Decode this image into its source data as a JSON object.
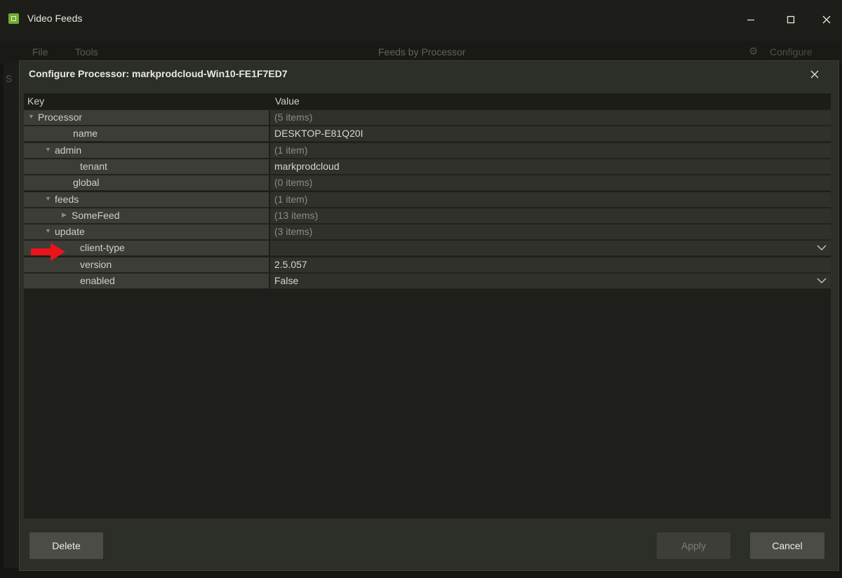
{
  "window": {
    "title": "Video Feeds",
    "controls": {
      "minimize": "—",
      "maximize": "☐",
      "close": "✕"
    }
  },
  "menubar": {
    "items": [
      {
        "label": "File"
      },
      {
        "label": "Tools"
      }
    ],
    "view_title": "Feeds by Processor",
    "configure_icon": "gear-icon",
    "configure_label": "Configure",
    "background_letter": "S"
  },
  "dialog": {
    "title": "Configure Processor: markprodcloud-Win10-FE1F7ED7",
    "close_icon": "✕",
    "columns": {
      "key": "Key",
      "value": "Value"
    },
    "rows": [
      {
        "key": "Processor",
        "value": "(5 items)",
        "depth": 0,
        "expander": "expanded"
      },
      {
        "key": "name",
        "value": "DESKTOP-E81Q20I",
        "depth": 1,
        "expander": "none"
      },
      {
        "key": "admin",
        "value": "(1 item)",
        "depth": 1,
        "expander": "expanded"
      },
      {
        "key": "tenant",
        "value": "markprodcloud",
        "depth": 2,
        "expander": "none"
      },
      {
        "key": "global",
        "value": "(0 items)",
        "depth": 1,
        "expander": "none"
      },
      {
        "key": "feeds",
        "value": "(1 item)",
        "depth": 1,
        "expander": "expanded"
      },
      {
        "key": "SomeFeed",
        "value": "(13 items)",
        "depth": 2,
        "expander": "collapsed"
      },
      {
        "key": "update",
        "value": "(3 items)",
        "depth": 1,
        "expander": "expanded"
      },
      {
        "key": "client-type",
        "value": "",
        "depth": 2,
        "expander": "none",
        "dropdown": true
      },
      {
        "key": "version",
        "value": "2.5.057",
        "depth": 2,
        "expander": "none"
      },
      {
        "key": "enabled",
        "value": "False",
        "depth": 2,
        "expander": "none",
        "dropdown": true
      }
    ],
    "buttons": {
      "delete": "Delete",
      "apply": "Apply",
      "cancel": "Cancel"
    },
    "annotation_color": "#e8131b"
  }
}
